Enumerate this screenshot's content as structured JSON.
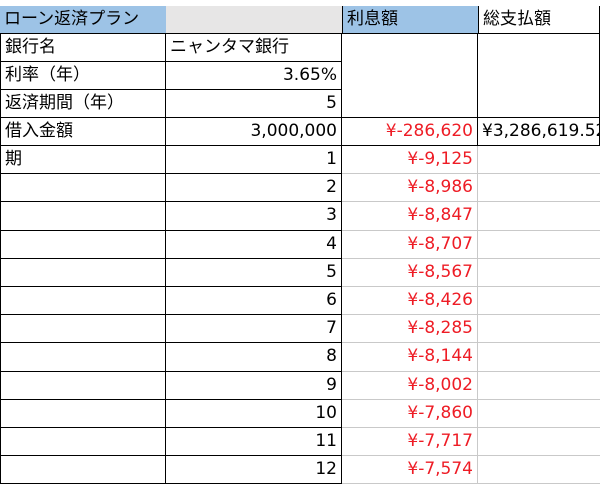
{
  "sheet": {
    "title": "ローン返済プラン",
    "interest_header": "利息額",
    "total_header": "総支払額",
    "bank_label": "銀行名",
    "bank_value": "ニャンタマ銀行",
    "rate_label": "利率（年）",
    "rate_value": "3.65%",
    "period_label": "返済期間（年）",
    "period_value": "5",
    "principal_label": "借入金額",
    "principal_value": "3,000,000",
    "total_interest": "¥-286,620",
    "total_payment": "¥3,286,619.52",
    "term_label": "期",
    "payments": [
      {
        "n": "1",
        "interest": "¥-9,125"
      },
      {
        "n": "2",
        "interest": "¥-8,986"
      },
      {
        "n": "3",
        "interest": "¥-8,847"
      },
      {
        "n": "4",
        "interest": "¥-8,707"
      },
      {
        "n": "5",
        "interest": "¥-8,567"
      },
      {
        "n": "6",
        "interest": "¥-8,426"
      },
      {
        "n": "7",
        "interest": "¥-8,285"
      },
      {
        "n": "8",
        "interest": "¥-8,144"
      },
      {
        "n": "9",
        "interest": "¥-8,002"
      },
      {
        "n": "10",
        "interest": "¥-7,860"
      },
      {
        "n": "11",
        "interest": "¥-7,717"
      },
      {
        "n": "12",
        "interest": "¥-7,574"
      }
    ]
  },
  "colors": {
    "header_blue": "#9dc3e6",
    "negative_red": "#ee1c25",
    "grey_fill": "#e7e6e6"
  }
}
